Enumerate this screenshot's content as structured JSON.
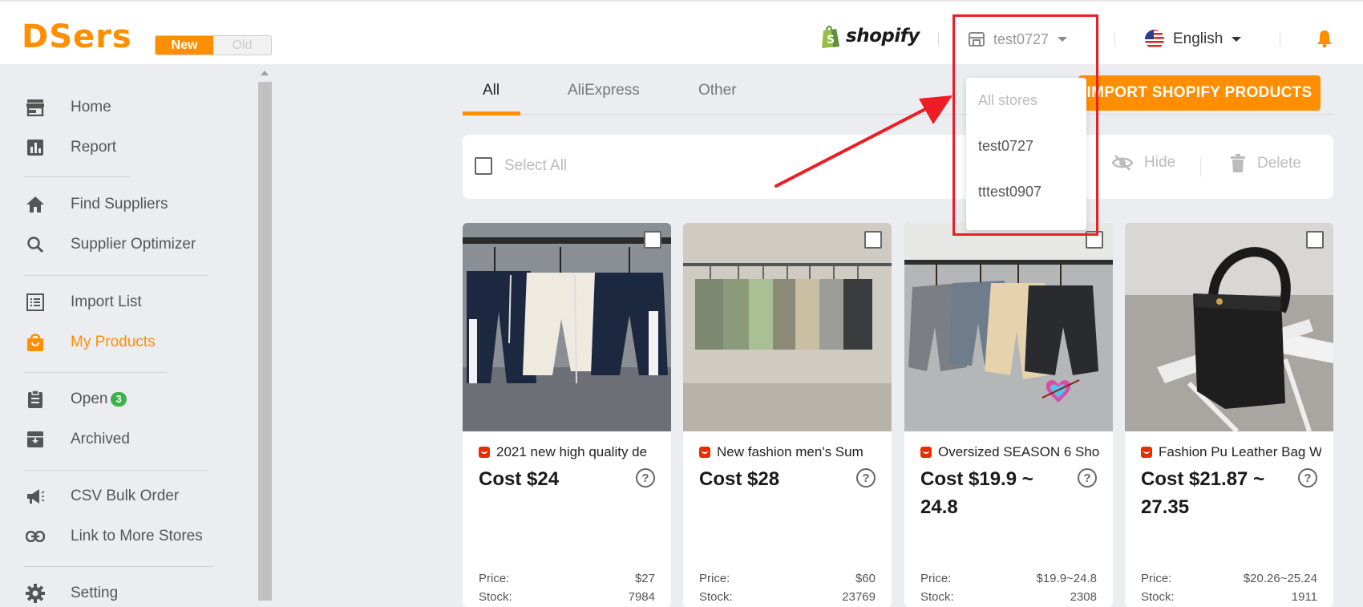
{
  "header": {
    "logo": "DSers",
    "version_new": "New",
    "version_old": "Old",
    "shopify_label": "shopify",
    "store_selected": "test0727",
    "language": "English"
  },
  "sidebar": {
    "items": [
      {
        "label": "Home",
        "icon": "store-icon"
      },
      {
        "label": "Report",
        "icon": "chart-icon"
      },
      {
        "label": "Find Suppliers",
        "icon": "home-icon"
      },
      {
        "label": "Supplier Optimizer",
        "icon": "search-icon"
      },
      {
        "label": "Import List",
        "icon": "list-icon"
      },
      {
        "label": "My Products",
        "icon": "bag-icon",
        "active": true
      },
      {
        "label": "Open",
        "icon": "clipboard-icon",
        "badge": "3"
      },
      {
        "label": "Archived",
        "icon": "archive-icon"
      },
      {
        "label": "CSV Bulk Order",
        "icon": "megaphone-icon"
      },
      {
        "label": "Link to More Stores",
        "icon": "link-icon"
      },
      {
        "label": "Setting",
        "icon": "gear-icon"
      }
    ]
  },
  "tabs": [
    "All",
    "AliExpress",
    "Other"
  ],
  "import_button": "IMPORT SHOPIFY PRODUCTS",
  "action_bar": {
    "select_all": "Select All",
    "hide": "Hide",
    "delete": "Delete"
  },
  "store_dropdown": {
    "options": [
      "All stores",
      "test0727",
      "tttest0907"
    ]
  },
  "products": [
    {
      "title": "2021 new high quality de",
      "cost": "Cost $24",
      "price_label": "Price:",
      "price": "$27",
      "stock_label": "Stock:",
      "stock": "7984"
    },
    {
      "title": "New fashion men's Sum",
      "cost": "Cost $28",
      "price_label": "Price:",
      "price": "$60",
      "stock_label": "Stock:",
      "stock": "23769"
    },
    {
      "title": "Oversized SEASON 6 Sho",
      "cost": "Cost $19.9 ~ 24.8",
      "price_label": "Price:",
      "price": "$19.9~24.8",
      "stock_label": "Stock:",
      "stock": "2308"
    },
    {
      "title": "Fashion Pu Leather Bag W",
      "cost": "Cost $21.87 ~ 27.35",
      "price_label": "Price:",
      "price": "$20.26~25.24",
      "stock_label": "Stock:",
      "stock": "1911"
    }
  ],
  "colors": {
    "accent": "#ff8f00",
    "highlight_red": "#ee1c24",
    "badge_green": "#3cb34a"
  }
}
